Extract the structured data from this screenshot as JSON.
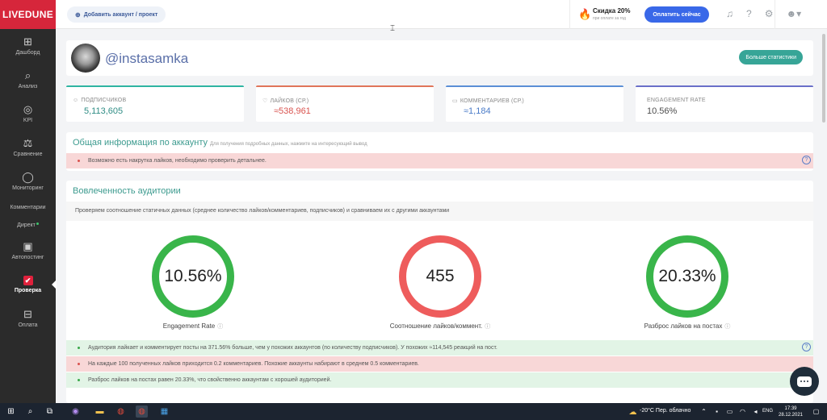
{
  "app": {
    "logo": "LIVEDUNE"
  },
  "sidebar": {
    "items": [
      {
        "label": "Дашборд",
        "icon": "grid-icon",
        "glyph": "⊞"
      },
      {
        "label": "Анализ",
        "icon": "search-icon",
        "glyph": "⌕"
      },
      {
        "label": "KPI",
        "icon": "target-icon",
        "glyph": "◎"
      },
      {
        "label": "Сравнение",
        "icon": "scales-icon",
        "glyph": "⚖"
      },
      {
        "label": "Мониторинг",
        "icon": "chat-bubble-icon",
        "glyph": "◯"
      },
      {
        "label": "Комментарии"
      },
      {
        "label": "Директ"
      },
      {
        "label": "Автопостинг",
        "icon": "calendar-icon",
        "glyph": "▣"
      },
      {
        "label": "Проверка",
        "icon": "check-icon",
        "glyph": "✔"
      },
      {
        "label": "Оплата",
        "icon": "basket-icon",
        "glyph": "⊟"
      }
    ]
  },
  "topbar": {
    "add_account": "Добавить аккаунт / проект",
    "promo_title": "Скидка 20%",
    "promo_subtitle": "при оплате за год",
    "pay_button": "Оплатить сейчас"
  },
  "profile": {
    "username": "@instasamka",
    "more_stats_button": "Больше статистики"
  },
  "stats": [
    {
      "label": "ПОДПИСЧИКОВ",
      "value": "5,113,605",
      "icon_glyph": "☺"
    },
    {
      "label": "ЛАЙКОВ (СР.)",
      "value": "≈538,961",
      "icon_glyph": "♡"
    },
    {
      "label": "КОММЕНТАРИЕВ (СР.)",
      "value": "≈1,184",
      "icon_glyph": "▭"
    },
    {
      "label": "ENGAGEMENT RATE",
      "value": "10.56%"
    }
  ],
  "general_info": {
    "title": "Общая информация по аккаунту",
    "hint": "Для получения подробных данных, нажмите на интересующий вывод",
    "alert": "Возможно есть накрутка лайков, необходимо проверить детальнее."
  },
  "engagement": {
    "title": "Вовлеченность аудитории",
    "description": "Проверяем соотношение статичных данных (среднее количество лайков/комментариев, подписчиков) и сравниваем их с другими аккаунтами",
    "metrics": [
      {
        "value": "10.56%",
        "label": "Engagement Rate",
        "color": "#39b54a"
      },
      {
        "value": "455",
        "label": "Соотношение лайков/коммент.",
        "color": "#ee5c5c"
      },
      {
        "value": "20.33%",
        "label": "Разброс лайков на постах",
        "color": "#39b54a"
      }
    ],
    "alerts": [
      {
        "text": "Аудитория лайкает и комментирует посты на 371.56% больше, чем у похожих аккаунтов (по количеству подписчиков). У похожих ≈114,545 реакций на пост.",
        "type": "green"
      },
      {
        "text": "На каждые 100 полученных лайков приходится 0.2 комментариев. Похожие аккаунты набирают в среднем 0.5 комментариев.",
        "type": "red"
      },
      {
        "text": "Разброс лайков на постах равен 20.33%, что свойственно аккаунтам с хорошей аудиторией.",
        "type": "green"
      }
    ]
  },
  "taskbar": {
    "weather": "-20°C  Пер. облачно",
    "lang": "ENG",
    "time": "17:39",
    "date": "28.12.2021"
  }
}
